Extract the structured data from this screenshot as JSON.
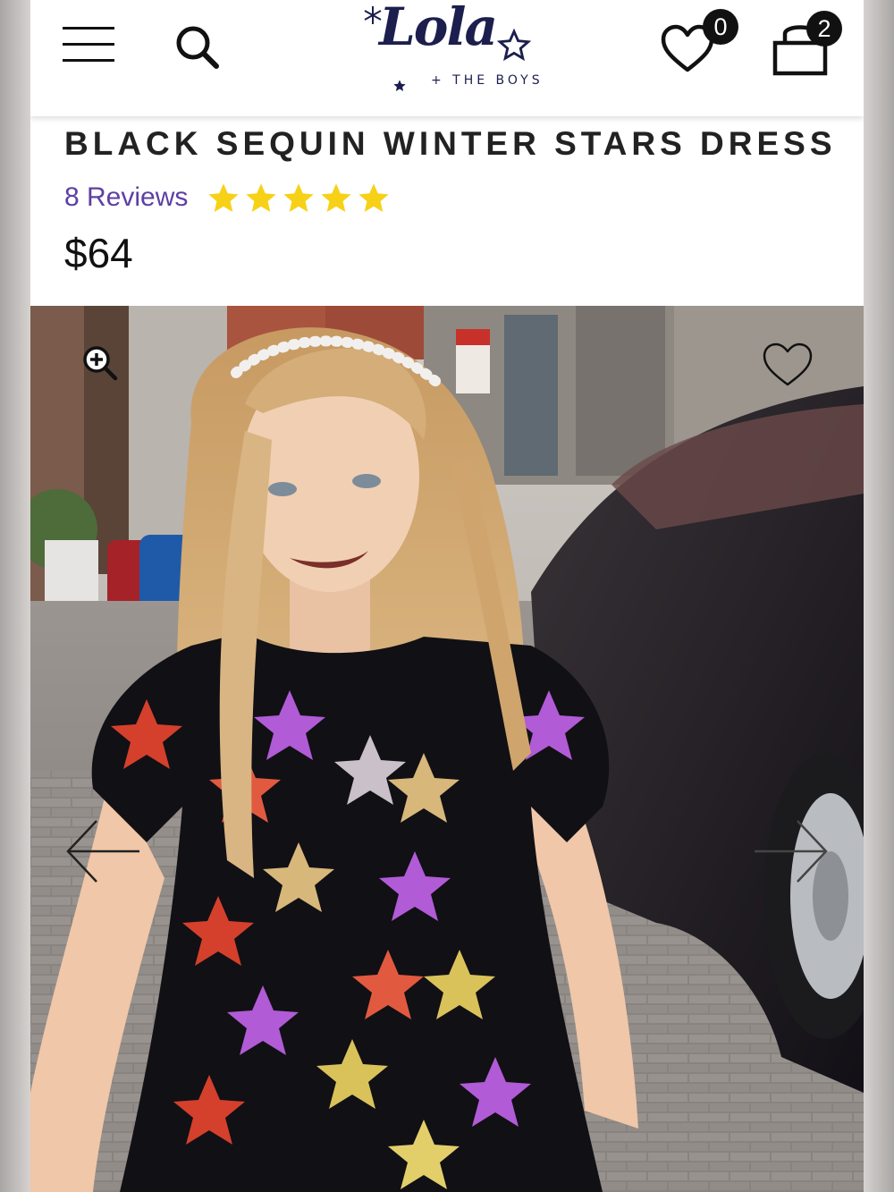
{
  "header": {
    "logo_text": "Lola",
    "logo_subtitle": "+ THE BOYS",
    "wishlist_count": "0",
    "cart_count": "2",
    "icons": [
      "menu-icon",
      "search-icon",
      "heart-icon",
      "shopping-bag-icon"
    ]
  },
  "product": {
    "title": "BLACK SEQUIN WINTER STARS DRESS",
    "reviews_label": "8 Reviews",
    "rating": 5,
    "rating_max": 5,
    "price": "$64"
  },
  "gallery": {
    "icons": [
      "zoom-in-icon",
      "heart-outline-icon",
      "arrow-left-icon",
      "arrow-right-icon"
    ]
  },
  "colors": {
    "brand_navy": "#1c1f4d",
    "reviews_purple": "#5e3fa3",
    "star_yellow": "#f7d117",
    "badge_black": "#111111"
  }
}
